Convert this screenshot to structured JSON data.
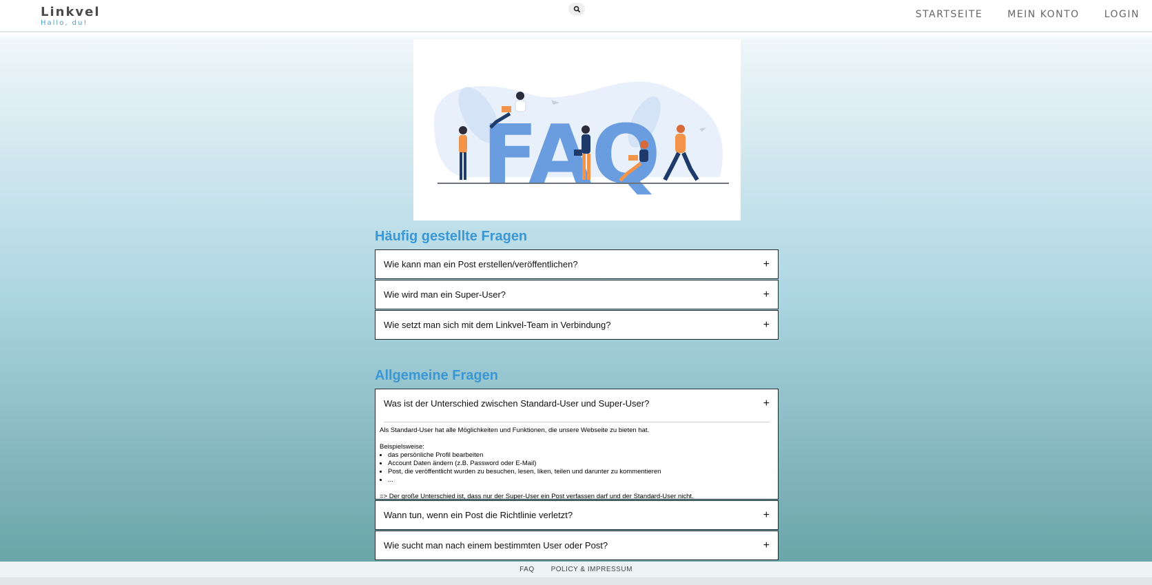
{
  "brand": {
    "name": "Linkvel",
    "tagline": "Hallo, du!"
  },
  "nav": {
    "items": [
      "STARTSEITE",
      "MEIN KONTO",
      "LOGIN"
    ]
  },
  "hero": {
    "letters": "FAQ"
  },
  "sections": [
    {
      "title": "Häufig gestellte Fragen",
      "questions": [
        "Wie kann man ein Post erstellen/veröffentlichen?",
        "Wie wird man ein Super-User?",
        "Wie setzt man sich mit dem Linkvel-Team in Verbindung?"
      ]
    },
    {
      "title": "Allgemeine Fragen",
      "questions": [
        "Was ist der Unterschied zwischen Standard-User und Super-User?",
        "Wann tun, wenn ein Post die Richtlinie verletzt?",
        "Wie sucht man nach einem bestimmten User oder Post?"
      ]
    }
  ],
  "expanded_answer": {
    "intro": "Als Standard-User hat alle Möglichkeiten und Funktionen, die unsere Webseite zu bieten hat.",
    "examples_label": "Beispielsweise:",
    "examples": [
      "das persönliche Profil bearbeiten",
      "Account Daten ändern (z.B. Password oder E-Mail)",
      "Post, die veröffentlicht wurden zu besuchen, lesen, liken, teilen und darunter zu kommentieren",
      "..."
    ],
    "conclusion": "=> Der große Unterschied ist, dass nur der Super-User ein Post verfassen darf und der Standard-User nicht."
  },
  "footer": {
    "links": [
      "FAQ",
      "POLICY & IMPRESSUM"
    ]
  },
  "colors": {
    "accent": "#3a97d4",
    "faq_blue": "#6a9de0",
    "orange": "#f2944a",
    "navy": "#1e3a6b"
  }
}
